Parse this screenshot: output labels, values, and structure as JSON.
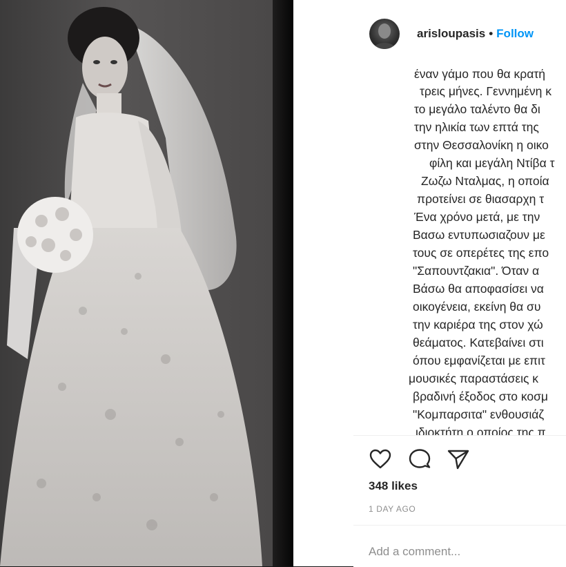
{
  "photo": {
    "alt": "Vintage black and white photo of a bride in a lace wedding dress holding a bouquet"
  },
  "header": {
    "username": "arisloupasis",
    "separator": "•",
    "follow_label": "Follow"
  },
  "caption": {
    "lines": [
      "έναν γάμο που θα κρατή",
      "τρεις μήνες. Γεννημένη κ",
      "το μεγάλο ταλέντο θα δι",
      "την ηλικία των επτά της",
      "στην Θεσσαλονίκη η οικο",
      "φίλη και μεγάλη Ντίβα τ",
      "Ζωζω Νταλμας, η οποία",
      "προτείνει σε θιασαρχη τ",
      "Ένα χρόνο μετά, με την",
      "Βασω εντυπωσιαζουν με",
      "τους σε οπερέτες της επο",
      "\"Σαπουντζακια\". Όταν α",
      "Βάσω θα αποφασίσει να",
      "οικογένεια, εκείνη θα συ",
      "την καριέρα της στον χώ",
      "θεάματος. Κατεβαίνει στι",
      "όπου εμφανίζεται με επιτ",
      "μουσικές παραστάσεις κ",
      "βραδινή έξοδος στο κοσμ",
      "\"Κομπαρσιτα\" ενθουσιάζ",
      "ιδιοκτήτη ο οποίος της π"
    ]
  },
  "actions": {
    "like_icon": "heart-icon",
    "comment_icon": "comment-icon",
    "share_icon": "paper-plane-icon",
    "likes_text": "348 likes",
    "time_text": "1 DAY AGO"
  },
  "comment": {
    "placeholder": "Add a comment..."
  },
  "colors": {
    "link_blue": "#0095f6",
    "text": "#262626",
    "muted": "#8e8e8e",
    "divider": "#efefef"
  }
}
